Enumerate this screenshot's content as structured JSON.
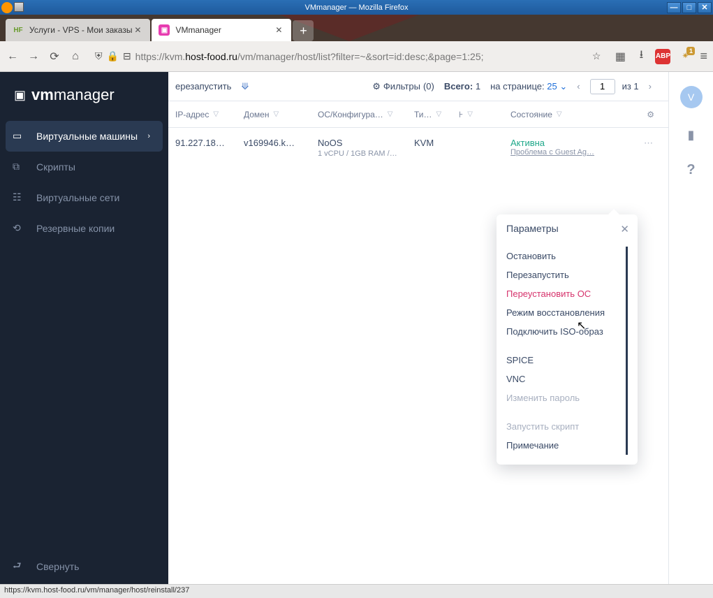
{
  "window": {
    "title": "VMmanager — Mozilla Firefox"
  },
  "tabs": [
    {
      "label": "Услуги - VPS - Мои заказы",
      "favicon_bg": "#fff",
      "favicon_text": "HF",
      "favicon_color": "#6a9c2f",
      "active": false
    },
    {
      "label": "VMmanager",
      "favicon_bg": "#e73cb0",
      "favicon_text": "▣",
      "favicon_color": "#fff",
      "active": true
    }
  ],
  "url": {
    "prefix": "https://kvm.",
    "domain": "host-food.ru",
    "path": "/vm/manager/host/list?filter=~&sort=id:desc;&page=1:25;"
  },
  "sidebar": {
    "brand_strong": "vm",
    "brand_light": "manager",
    "items": [
      {
        "label": "Виртуальные машины",
        "icon": "▭",
        "active": true
      },
      {
        "label": "Скрипты",
        "icon": "⧉",
        "active": false
      },
      {
        "label": "Виртуальные сети",
        "icon": "☷",
        "active": false
      },
      {
        "label": "Резервные копии",
        "icon": "⟲",
        "active": false
      }
    ],
    "collapse": "Свернуть"
  },
  "toolbar": {
    "restart": "ерезапустить",
    "filters_label": "Фильтры",
    "filters_count": "(0)",
    "total_label": "Всего:",
    "total_value": "1",
    "perpage_label": "на странице:",
    "perpage_value": "25",
    "page_input": "1",
    "of_label": "из",
    "of_total": "1"
  },
  "columns": {
    "ip": "IP-адрес",
    "domain": "Домен",
    "os": "ОС/Конфигура…",
    "type": "Ти…",
    "h": "⊦",
    "state": "Состояние"
  },
  "row": {
    "ip": "91.227.18…",
    "domain": "v169946.k…",
    "os": "NoOS",
    "os_sub": "1 vCPU / 1GB RAM /…",
    "type": "KVM",
    "state": "Активна",
    "state_sub": "Проблема с Guest Ag…"
  },
  "popover": {
    "title": "Параметры",
    "items": [
      {
        "label": "Остановить",
        "kind": "normal"
      },
      {
        "label": "Перезапустить",
        "kind": "normal"
      },
      {
        "label": "Переустановить ОС",
        "kind": "highlight"
      },
      {
        "label": "Режим восстановления",
        "kind": "normal"
      },
      {
        "label": "Подключить ISO-образ",
        "kind": "normal"
      },
      {
        "label": "",
        "kind": "sep"
      },
      {
        "label": "SPICE",
        "kind": "normal"
      },
      {
        "label": "VNC",
        "kind": "normal"
      },
      {
        "label": "Изменить пароль",
        "kind": "disabled"
      },
      {
        "label": "",
        "kind": "sep"
      },
      {
        "label": "Запустить скрипт",
        "kind": "disabled"
      },
      {
        "label": "Примечание",
        "kind": "normal"
      }
    ]
  },
  "right": {
    "avatar": "V"
  },
  "status": "https://kvm.host-food.ru/vm/manager/host/reinstall/237"
}
